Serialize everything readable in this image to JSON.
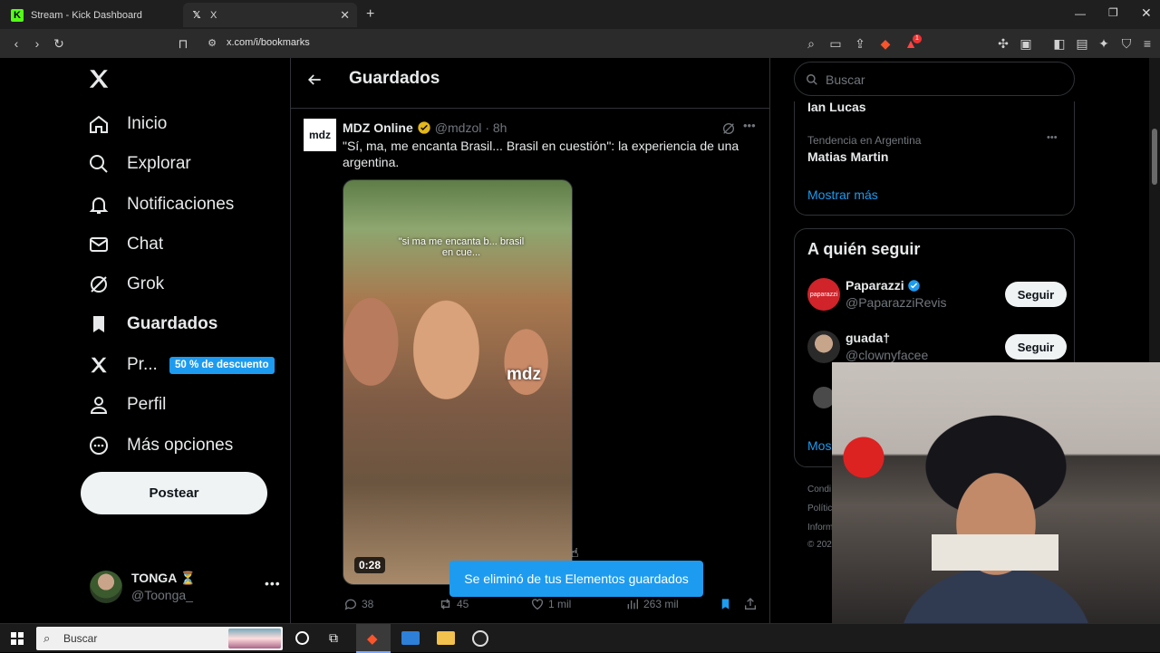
{
  "browser": {
    "tabs": [
      {
        "label": "Stream - Kick Dashboard",
        "icon": "kick-icon"
      },
      {
        "label": "X",
        "icon": "x-icon"
      }
    ],
    "new_tab": "+",
    "url": "x.com/i/bookmarks",
    "shield_badge": "1"
  },
  "nav": {
    "items": [
      {
        "label": "Inicio",
        "icon": "home-icon"
      },
      {
        "label": "Explorar",
        "icon": "search-icon"
      },
      {
        "label": "Notificaciones",
        "icon": "bell-icon"
      },
      {
        "label": "Chat",
        "icon": "mail-icon"
      },
      {
        "label": "Grok",
        "icon": "grok-icon"
      },
      {
        "label": "Guardados",
        "icon": "bookmark-icon"
      },
      {
        "label": "Pr...",
        "icon": "x-premium-icon"
      },
      {
        "label": "Perfil",
        "icon": "person-icon"
      },
      {
        "label": "Más opciones",
        "icon": "more-circle-icon"
      }
    ],
    "promo_badge": "50 % de descuento",
    "post_button": "Postear",
    "account": {
      "name": "TONGA ⏳",
      "handle": "@Toonga_"
    }
  },
  "header": {
    "title": "Guardados"
  },
  "tweet": {
    "author": "MDZ Online",
    "handle": "@mdzol",
    "time": "· 8h",
    "avatar_text": "mdz",
    "text": "\"Sí, ma, me encanta Brasil... Brasil en cuestión\": la experiencia de una argentina.",
    "video_overlay": "\"si ma me encanta b... brasil en cue...",
    "video_watermark": "mdz",
    "duration": "0:28",
    "replies": "38",
    "retweets": "45",
    "likes": "1 mil",
    "views": "263 mil"
  },
  "toast": "Se eliminó de tus Elementos guardados",
  "right": {
    "search_placeholder": "Buscar",
    "trend_top": "Ian Lucas",
    "trend_meta": "Tendencia en Argentina",
    "trend_name": "Matias Martin",
    "show_more": "Mostrar más",
    "follow_title": "A quién seguir",
    "suggestions": [
      {
        "name": "Paparazzi",
        "handle": "@PaparazziRevis",
        "button": "Seguir",
        "verified": true
      },
      {
        "name": "guada†",
        "handle": "@clownyfacee",
        "button": "Seguir",
        "verified": false
      }
    ],
    "show_more_partial": "Mos",
    "footer_partial": [
      "Condi",
      "Polític",
      "Inform",
      "© 202"
    ]
  },
  "taskbar": {
    "search_placeholder": "Buscar"
  },
  "colors": {
    "accent": "#1d9bf0",
    "bg": "#000000",
    "border": "#2f3336",
    "muted": "#71767b"
  }
}
